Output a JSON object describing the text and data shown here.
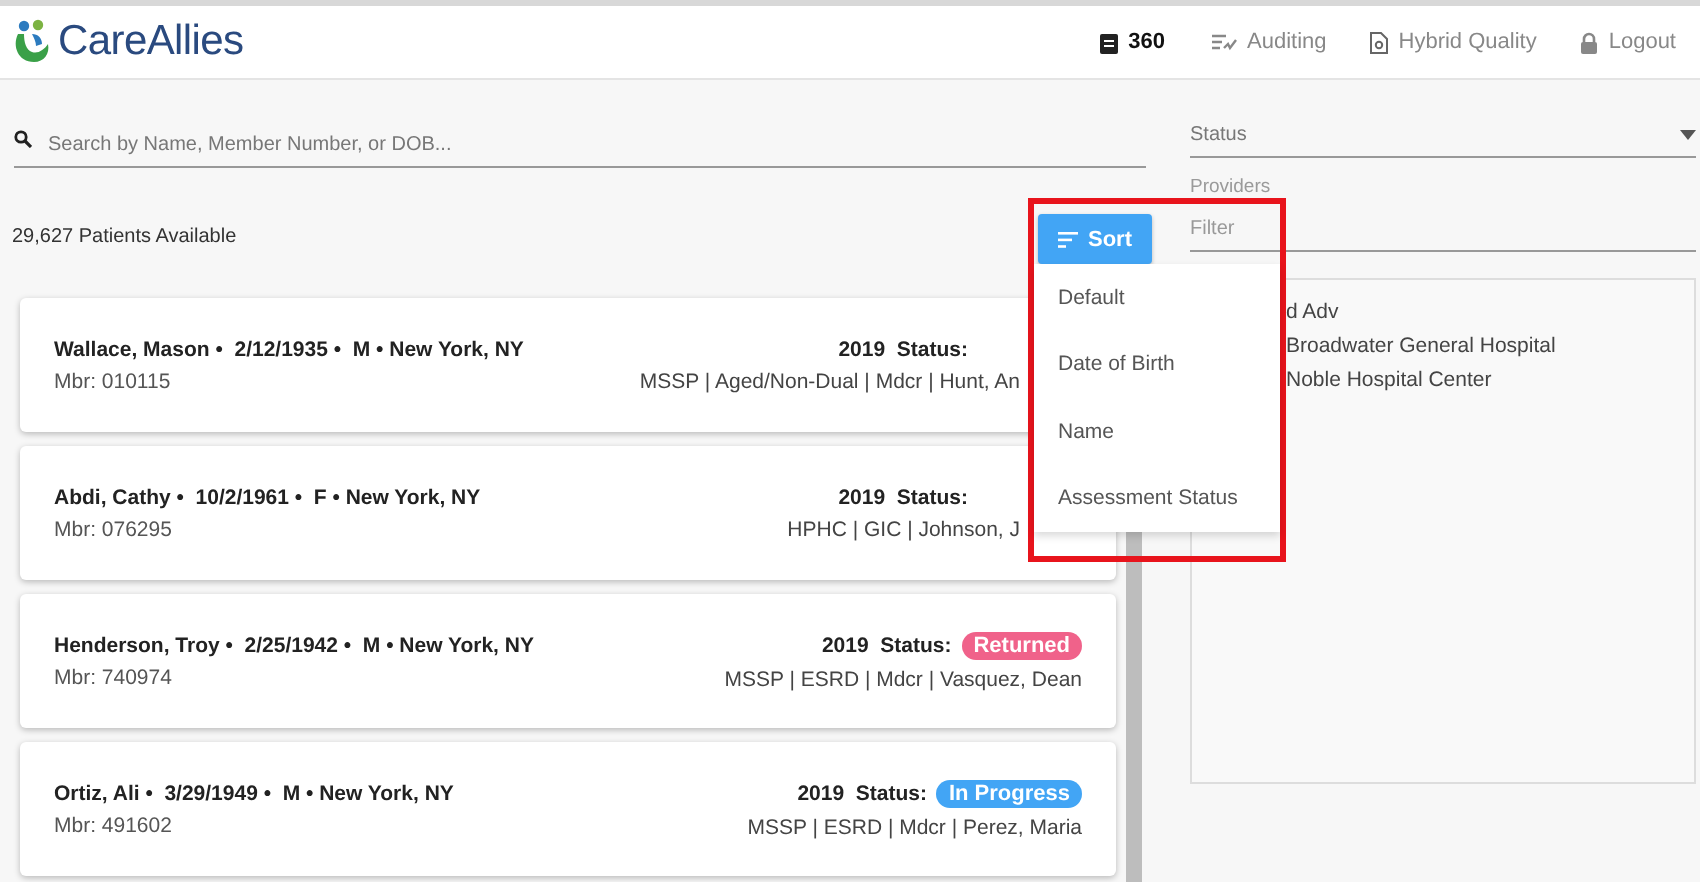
{
  "header": {
    "logo": "CareAllies",
    "nav": [
      {
        "label": "360",
        "selected": true
      },
      {
        "label": "Auditing",
        "selected": false
      },
      {
        "label": "Hybrid Quality",
        "selected": false
      },
      {
        "label": "Logout",
        "selected": false
      }
    ]
  },
  "search": {
    "placeholder": "Search by Name, Member Number, or DOB..."
  },
  "patient_count": "29,627 Patients Available",
  "sort": {
    "label": "Sort",
    "options": [
      "Default",
      "Date of Birth",
      "Name",
      "Assessment Status"
    ]
  },
  "filters": {
    "status": {
      "placeholder": "Status"
    },
    "providers_label": "Providers",
    "filter": {
      "placeholder": "Filter"
    },
    "providers": [
      "d Adv",
      "Broadwater General Hospital",
      "Noble Hospital Center"
    ]
  },
  "patients": [
    {
      "title": "Wallace, Mason •  2/12/1935 •  M • New York, NY",
      "member": "Mbr: 010115",
      "status_label": "2019  Status:",
      "details": "MSSP | Aged/Non-Dual | Mdcr | Hunt, An"
    },
    {
      "title": "Abdi, Cathy •  10/2/1961 •  F • New York, NY",
      "member": "Mbr: 076295",
      "status_label": "2019  Status:",
      "details": "HPHC | GIC | Johnson, J"
    },
    {
      "title": "Henderson, Troy •  2/25/1942 •  M • New York, NY",
      "member": "Mbr: 740974",
      "status_label": "2019  Status:",
      "badge": {
        "text": "Returned",
        "color": "#f0628a"
      },
      "details": "MSSP | ESRD | Mdcr | Vasquez, Dean"
    },
    {
      "title": "Ortiz, Ali •  3/29/1949 •  M • New York, NY",
      "member": "Mbr: 491602",
      "status_label": "2019  Status:",
      "badge": {
        "text": "In Progress",
        "color": "#42a5f5"
      },
      "details": "MSSP | ESRD | Mdcr | Perez, Maria"
    }
  ]
}
